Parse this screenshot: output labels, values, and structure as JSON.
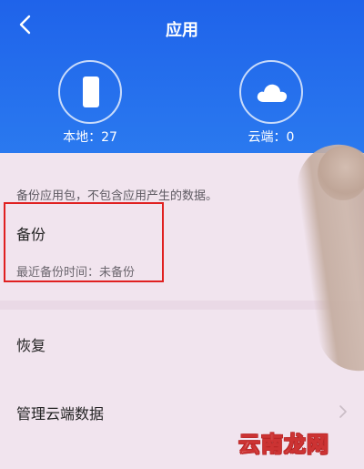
{
  "header": {
    "title": "应用",
    "local_label": "本地：27",
    "cloud_label": "云端：0"
  },
  "note": "备份应用包，不包含应用产生的数据。",
  "items": {
    "backup": {
      "title": "备份",
      "subtitle": "最近备份时间：未备份"
    },
    "restore": {
      "title": "恢复"
    },
    "manage": {
      "title": "管理云端数据"
    }
  },
  "watermark": "云南龙网",
  "colors": {
    "header": "#2a79ef",
    "highlight": "#e02020",
    "background": "#f1e4ee"
  },
  "icons": [
    "back-arrow-icon",
    "phone-icon",
    "cloud-icon",
    "chevron-right-icon"
  ]
}
